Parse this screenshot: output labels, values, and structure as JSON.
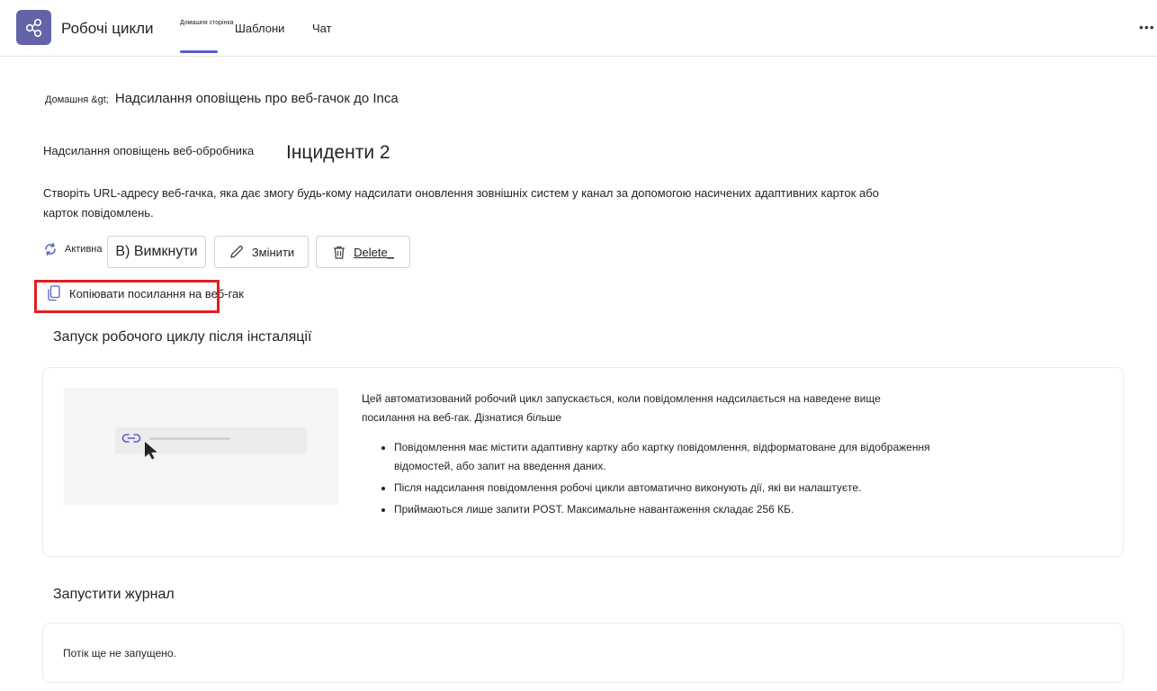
{
  "header": {
    "app_title": "Робочі цикли",
    "tabs": [
      {
        "label": "Домашня сторінка"
      },
      {
        "label": "Шаблони"
      },
      {
        "label": "Чат"
      }
    ],
    "more_label": "•••"
  },
  "breadcrumb": {
    "home": "Домашня &gt;",
    "current": "Надсилання оповіщень про веб-гачок до Inca"
  },
  "workflow": {
    "subtitle": "Надсилання оповіщень веб-обробника",
    "name": "Інциденти 2",
    "description": "Створіть URL-адресу веб-гачка, яка дає змогу будь-кому надсилати оновлення зовнішніх систем у канал за допомогою насичених адаптивних карток або карток повідомлень."
  },
  "actions": {
    "status": "Активна",
    "turn_off": "В) Вимкнути",
    "edit": "Змінити",
    "delete": "Delete_"
  },
  "copy_link": {
    "label": "Копіювати посилання на веб-гак"
  },
  "trigger_section": {
    "title": "Запуск робочого циклу після інсталяції",
    "intro": "Цей автоматизований робочий цикл запускається, коли повідомлення надсилається на наведене вище посилання на веб-гак. Дізнатися більше",
    "bullets": [
      "Повідомлення має містити адаптивну картку або картку повідомлення, відформатоване для відображення відомостей, або запит на введення даних.",
      "Після надсилання повідомлення робочі цикли автоматично виконують дії, які ви налаштуєте.",
      "Приймаються лише запити POST. Максимальне навантаження складає 256 КБ."
    ]
  },
  "log_section": {
    "title": "Запустити журнал",
    "empty_text": "Потік ще не запущено."
  },
  "colors": {
    "accent": "#5b5fc7",
    "app_icon": "#6264a7",
    "highlight": "#e02020"
  }
}
